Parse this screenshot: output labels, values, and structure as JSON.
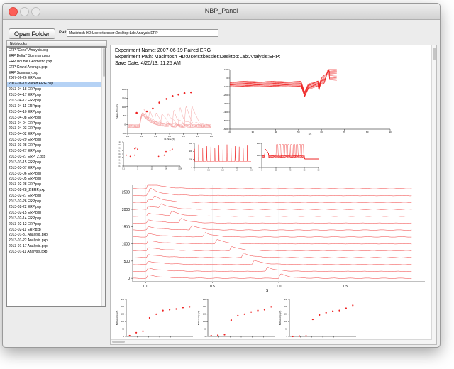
{
  "window": {
    "title": "NBP_Panel"
  },
  "toolbar": {
    "open_folder_label": "Open Folder",
    "path_label": "Path",
    "path_value": "Macintosh HD:Users:tkessler:Desktop:Lab:Analysis:ERP"
  },
  "tabs": [
    {
      "label": "Notebooks"
    }
  ],
  "sidebar": {
    "selected": "2007-06-19 Paired ERG.pxp",
    "items": [
      "ERP \"Cone\" Analysis.pxp",
      "ERP DeltaT Summary.pxp",
      "ERP Double Geometric.pxp",
      "ERP Grand Average.pxp",
      "ERP Summary.pxp",
      "2007-06-26 ERP.pxp",
      "2007-06-19 Paired ERG.pxp",
      "2013-04-18 ERP.pxp",
      "2013-04-17 ERP.pxp",
      "2013-04-12 ERP.pxp",
      "2013-04-11 ERP.pxp",
      "2013-04-10 ERP.pxp",
      "2013-04-08 ERP.pxp",
      "2013-04-04 ERP.pxp",
      "2013-04-03 ERP.pxp",
      "2013-04-02 ERP.pxp",
      "2013-03-29 ERP.pxp",
      "2013-03-28 ERP.pxp",
      "2013-03-27 ERP.pxp",
      "2013-03-27 ERP_2.pxp",
      "2013-03-15 ERP.pxp",
      "2013-03-07 ERP.pxp",
      "2013-03-06 ERP.pxp",
      "2013-03-05 ERP.pxp",
      "2013-02-28 ERP.pxp",
      "2013-02-28_2 ERP.pxp",
      "2013-02-27 ERP.pxp",
      "2013-02-26 ERP.pxp",
      "2013-02-22 ERP.pxp",
      "2013-02-15 ERP.pxp",
      "2013-02-14 ERP.pxp",
      "2013-02-12 ERP.pxp",
      "2013-02-11 ERP.pxp",
      "2013-01-31 Analysis.pxp",
      "2013-01-22 Analysis.pxp",
      "2013-01-17 Analysis.pxp",
      "2013-01-11 Analysis.pxp"
    ]
  },
  "experiment": {
    "name_line": "Experiment Name: 2007-06-19 Paired ERG",
    "path_line": "Experiment Path: Macintosh HD:Users:tkessler:Desktop:Lab:Analysis:ERP:",
    "date_line": "Save Date: 4/20/13, 11:25 AM"
  },
  "colors": {
    "trace": "#ee2222",
    "trace_light": "#f5a3a3",
    "selection": "#b5d2f5",
    "close": "#fc5f57"
  },
  "chart_data": [
    {
      "type": "line",
      "xlabel": "IS Time (S)",
      "ylabel": "Pulses Amp (µV)",
      "xlim": [
        -0.2,
        1.2
      ],
      "ylim": [
        -50,
        250
      ],
      "x_ticks": [
        "0.0",
        "0.2",
        "0.4",
        "0.6",
        "0.8",
        "1.0",
        "1.2"
      ],
      "y_ticks": [
        "200",
        "150",
        "100",
        "50",
        "0",
        "-50"
      ],
      "markers": [
        [
          -0.05,
          90
        ],
        [
          0.12,
          100
        ],
        [
          0.22,
          120
        ],
        [
          0.33,
          160
        ],
        [
          0.45,
          185
        ],
        [
          0.55,
          205
        ],
        [
          0.65,
          215
        ],
        [
          0.75,
          225
        ],
        [
          0.86,
          230
        ]
      ]
    },
    {
      "type": "line",
      "xlabel": "mS",
      "xlim": [
        10,
        100
      ],
      "ylim": [
        -700,
        200
      ],
      "x_ticks": [
        "20",
        "30",
        "40",
        "50",
        "60",
        "70",
        "80",
        "90"
      ],
      "y_ticks": [
        "100",
        "0",
        "-100",
        "-200",
        "-300",
        "-400",
        "-500",
        "-600"
      ]
    },
    {
      "type": "scatter",
      "x_ticks": [
        "0.1",
        "1",
        "10",
        "100",
        "1000"
      ],
      "y_ticks": [
        "1.0",
        "0.9",
        "0.8",
        "0.7",
        "0.6",
        "0.5",
        "0.4",
        "0.3",
        "0.2"
      ]
    },
    {
      "type": "line",
      "x_ticks": [
        "0",
        "0.5",
        "1.0",
        "1.5",
        "2.0"
      ],
      "y_ticks": [
        "300",
        "200",
        "100",
        "0"
      ]
    },
    {
      "type": "line",
      "x_ticks": [
        "0",
        "20",
        "40",
        "60",
        "80"
      ],
      "y_ticks": [
        "200",
        "100",
        "0"
      ]
    },
    {
      "type": "line",
      "xlabel": "S",
      "xlim": [
        -0.1,
        2.1
      ],
      "ylim": [
        -100,
        2700
      ],
      "x_ticks": [
        "0.0",
        "0.5",
        "1.0",
        "1.5"
      ],
      "y_ticks": [
        "2500",
        "2000",
        "1500",
        "1000",
        "500",
        "0"
      ],
      "offsets": [
        0,
        200,
        400,
        600,
        800,
        1000,
        1200,
        1400,
        1600,
        1800,
        2000,
        2200,
        2400,
        2600
      ],
      "flash2_times": [
        1.0,
        0.9,
        0.8,
        0.72,
        0.63,
        0.52,
        0.43,
        0.33,
        0.25,
        0.18,
        0.1,
        0.05,
        0.02,
        0.01
      ]
    },
    {
      "type": "scatter",
      "ylabel": "B Wave Amp (µV)",
      "y_ticks": [
        "250",
        "200",
        "150",
        "100",
        "50",
        "0"
      ],
      "points": [
        [
          0.05,
          5
        ],
        [
          0.15,
          25
        ],
        [
          0.25,
          35
        ],
        [
          0.35,
          125
        ],
        [
          0.45,
          150
        ],
        [
          0.55,
          175
        ],
        [
          0.65,
          180
        ],
        [
          0.75,
          185
        ],
        [
          0.85,
          195
        ],
        [
          0.95,
          200
        ]
      ]
    },
    {
      "type": "scatter",
      "ylabel": "B Wave Amp (µV)",
      "y_ticks": [
        "250",
        "200",
        "150",
        "100",
        "50",
        "0"
      ],
      "points": [
        [
          0.05,
          5
        ],
        [
          0.15,
          8
        ],
        [
          0.25,
          12
        ],
        [
          0.35,
          110
        ],
        [
          0.45,
          140
        ],
        [
          0.55,
          150
        ],
        [
          0.65,
          165
        ],
        [
          0.75,
          175
        ],
        [
          0.85,
          180
        ],
        [
          0.95,
          200
        ]
      ]
    },
    {
      "type": "scatter",
      "ylabel": "B Wave Amp (µV)",
      "y_ticks": [
        "250",
        "200",
        "150",
        "100",
        "50",
        "0"
      ],
      "points": [
        [
          0.05,
          0
        ],
        [
          0.15,
          2
        ],
        [
          0.25,
          3
        ],
        [
          0.35,
          115
        ],
        [
          0.45,
          145
        ],
        [
          0.55,
          160
        ],
        [
          0.65,
          170
        ],
        [
          0.75,
          175
        ],
        [
          0.85,
          190
        ],
        [
          0.95,
          210
        ]
      ]
    }
  ]
}
